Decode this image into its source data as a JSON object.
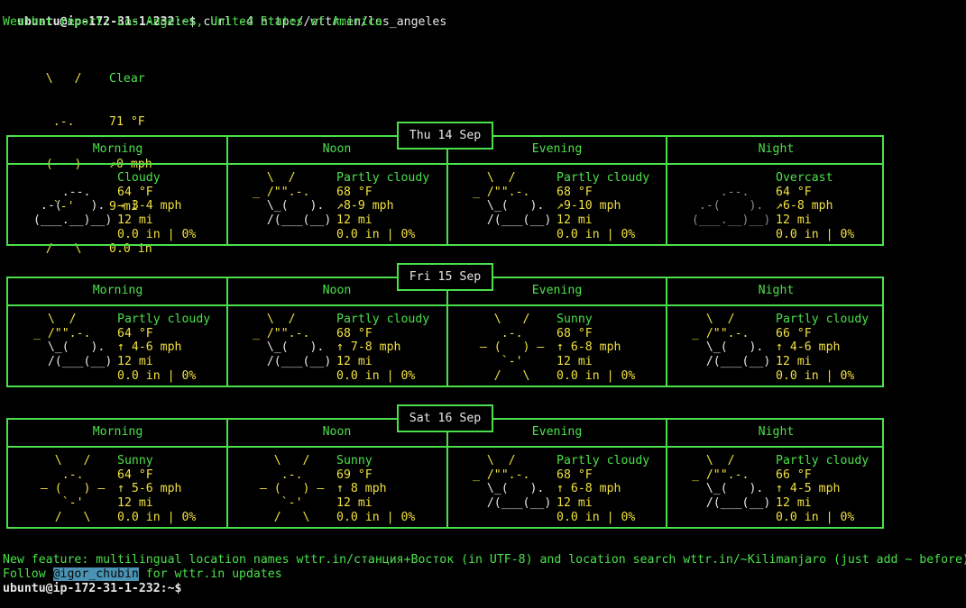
{
  "terminal": {
    "prompt1": "ubuntu@ip-172-31-1-232:~$",
    "command": " curl -4 http://wttr.in/los_angeles",
    "report_title": "Weather report: Los Angeles, United States of America",
    "prompt2": "ubuntu@ip-172-31-1-232:~$"
  },
  "current": {
    "art": [
      "    \\   /    ",
      "     .-.     ",
      "  ― (   ) ―  ",
      "     `-'     ",
      "    /   \\    "
    ],
    "condition": "Clear",
    "temp": "71 °F",
    "wind": "↗0 mph",
    "visibility": "9 mi",
    "precip": "0.0 in"
  },
  "days": [
    {
      "date": "Thu 14 Sep",
      "periods": [
        {
          "name": "Morning",
          "art_type": "cloudy",
          "condition": "Cloudy",
          "temp": "64 °F",
          "wind": "→ 3-4 mph",
          "visibility": "12 mi",
          "precip": "0.0 in | 0%"
        },
        {
          "name": "Noon",
          "art_type": "partly",
          "condition": "Partly cloudy",
          "temp": "68 °F",
          "wind": "↗8-9 mph",
          "visibility": "12 mi",
          "precip": "0.0 in | 0%"
        },
        {
          "name": "Evening",
          "art_type": "partly",
          "condition": "Partly cloudy",
          "temp": "68 °F",
          "wind": "↗9-10 mph",
          "visibility": "12 mi",
          "precip": "0.0 in | 0%"
        },
        {
          "name": "Night",
          "art_type": "overcast",
          "condition": "Overcast",
          "temp": "64 °F",
          "wind": "↗6-8 mph",
          "visibility": "12 mi",
          "precip": "0.0 in | 0%"
        }
      ]
    },
    {
      "date": "Fri 15 Sep",
      "periods": [
        {
          "name": "Morning",
          "art_type": "partly",
          "condition": "Partly cloudy",
          "temp": "64 °F",
          "wind": "↑ 4-6 mph",
          "visibility": "12 mi",
          "precip": "0.0 in | 0%"
        },
        {
          "name": "Noon",
          "art_type": "partly",
          "condition": "Partly cloudy",
          "temp": "68 °F",
          "wind": "↑ 7-8 mph",
          "visibility": "12 mi",
          "precip": "0.0 in | 0%"
        },
        {
          "name": "Evening",
          "art_type": "sunny",
          "condition": "Sunny",
          "temp": "68 °F",
          "wind": "↑ 6-8 mph",
          "visibility": "12 mi",
          "precip": "0.0 in | 0%"
        },
        {
          "name": "Night",
          "art_type": "partly",
          "condition": "Partly cloudy",
          "temp": "66 °F",
          "wind": "↑ 4-6 mph",
          "visibility": "12 mi",
          "precip": "0.0 in | 0%"
        }
      ]
    },
    {
      "date": "Sat 16 Sep",
      "periods": [
        {
          "name": "Morning",
          "art_type": "sunny",
          "condition": "Sunny",
          "temp": "64 °F",
          "wind": "↑ 5-6 mph",
          "visibility": "12 mi",
          "precip": "0.0 in | 0%"
        },
        {
          "name": "Noon",
          "art_type": "sunny",
          "condition": "Sunny",
          "temp": "69 °F",
          "wind": "↑ 8 mph",
          "visibility": "12 mi",
          "precip": "0.0 in | 0%"
        },
        {
          "name": "Evening",
          "art_type": "partly",
          "condition": "Partly cloudy",
          "temp": "68 °F",
          "wind": "↑ 6-8 mph",
          "visibility": "12 mi",
          "precip": "0.0 in | 0%"
        },
        {
          "name": "Night",
          "art_type": "partly",
          "condition": "Partly cloudy",
          "temp": "66 °F",
          "wind": "↑ 4-5 mph",
          "visibility": "12 mi",
          "precip": "0.0 in | 0%"
        }
      ]
    }
  ],
  "art_library": {
    "cloudy": [
      "             ",
      "     .--.    ",
      "  .-(    ).  ",
      " (___.__)__) ",
      "             "
    ],
    "overcast": [
      "             ",
      "     .--.    ",
      "  .-(    ).  ",
      " (___.__)__) ",
      "             "
    ],
    "partly": [
      "   \\  /      ",
      " _ /\"\".-.    ",
      "   \\_(   ).  ",
      "   /(___(__) ",
      "             "
    ],
    "sunny": [
      "    \\   /    ",
      "     .-.     ",
      "  ― (   ) ―  ",
      "     `-'     ",
      "    /   \\    "
    ]
  },
  "footer": {
    "feature_line": "New feature: multilingual location names wttr.in/станция+Восток (in UTF-8) and location search wttr.in/~Kilimanjaro (just add ~ before)",
    "follow_prefix": "Follow ",
    "handle": "@igor_chubin",
    "follow_suffix": " for wttr.in updates"
  },
  "colors": {
    "background": "#000000",
    "text_green": "#4be04b",
    "text_yellow": "#f0e040",
    "text_white": "#e6e6e6",
    "cloud_gray": "#8a8a8a",
    "handle_highlight": "#4a93b5"
  }
}
